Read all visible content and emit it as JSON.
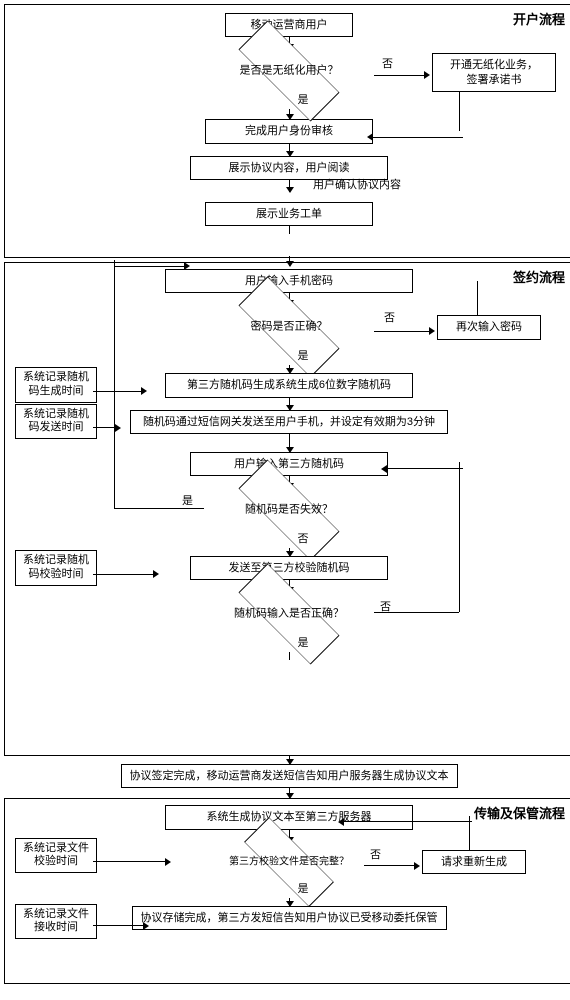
{
  "sections": {
    "open": {
      "title": "开户流程"
    },
    "sign": {
      "title": "签约流程"
    },
    "store": {
      "title": "传输及保管流程"
    }
  },
  "open": {
    "start": "移动运营商用户",
    "d1": "是否是无纸化用户？",
    "d1_no": "否",
    "d1_yes": "是",
    "paperless": "开通无纸化业务，\n签署承诺书",
    "verify": "完成用户身份审核",
    "showAgreement": "展示协议内容，用户阅读",
    "confirm": "用户确认协议内容",
    "workorder": "展示业务工单"
  },
  "sign": {
    "inputPwd": "用户输入手机密码",
    "d_pwd": "密码是否正确？",
    "pwd_no": "否",
    "pwd_yes": "是",
    "rePwd": "再次输入密码",
    "side_genTime": "系统记录随机码生成时间",
    "genCode": "第三方随机码生成系统生成6位数字随机码",
    "side_sendTime": "系统记录随机码发送时间",
    "sendCode": "随机码通过短信网关发送至用户手机，并设定有效期为3分钟",
    "inputCode": "用户输入第三方随机码",
    "d_expired": "随机码是否失效？",
    "exp_yes": "是",
    "exp_no": "否",
    "side_checkTime": "系统记录随机码校验时间",
    "checkCode": "发送至第三方校验随机码",
    "d_codeOk": "随机码输入是否正确？",
    "code_no": "否",
    "code_yes": "是",
    "done": "协议签定完成，移动运营商发送短信告知用户服务器生成协议文本"
  },
  "store": {
    "gen": "系统生成协议文本至第三方服务器",
    "side_fileCheck": "系统记录文件校验时间",
    "d_file": "第三方校验文件是否完整？",
    "file_no": "否",
    "file_yes": "是",
    "reReq": "请求重新生成",
    "side_recvTime": "系统记录文件接收时间",
    "stored": "协议存储完成，第三方发短信告知用户协议已受移动委托保管"
  }
}
